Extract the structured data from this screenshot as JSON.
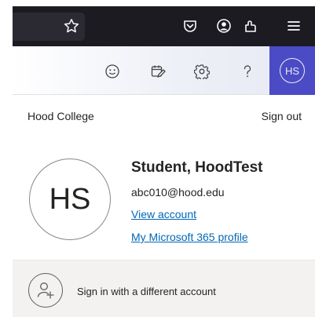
{
  "firefox_toolbar": {
    "icons": [
      "star-bookmark-icon",
      "pocket-icon",
      "account-icon",
      "extensions-icon",
      "menu-icon"
    ]
  },
  "office_header": {
    "icons": [
      "feedback-smiley-icon",
      "whats-new-icon",
      "settings-gear-icon",
      "help-question-icon"
    ],
    "avatar_initials": "HS",
    "accent_color": "#4b4bc6"
  },
  "account_panel": {
    "organization": "Hood College",
    "sign_out_label": "Sign out",
    "avatar_initials": "HS",
    "display_name": "Student, HoodTest",
    "email": "abc010@hood.edu",
    "view_account_label": "View account",
    "profile_label": "My Microsoft 365 profile",
    "link_color": "#0067b8"
  },
  "footer": {
    "sign_in_other_label": "Sign in with a different account"
  }
}
